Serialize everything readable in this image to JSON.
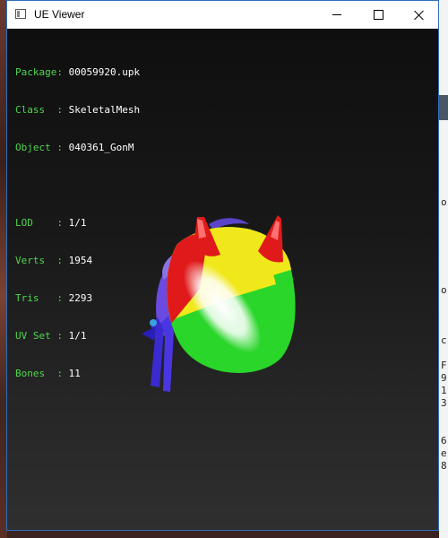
{
  "window": {
    "title": "UE Viewer",
    "controls": [
      "minimize",
      "maximize",
      "close"
    ]
  },
  "info_panel": {
    "asset": [
      {
        "key": "Package",
        "sep": ": ",
        "value": "00059920.upk"
      },
      {
        "key": "Class  ",
        "sep": ": ",
        "value": "SkeletalMesh"
      },
      {
        "key": "Object ",
        "sep": ": ",
        "value": "040361_GonM"
      }
    ],
    "stats": [
      {
        "key": "LOD    ",
        "sep": ": ",
        "value": "1/1"
      },
      {
        "key": "Verts  ",
        "sep": ": ",
        "value": "1954"
      },
      {
        "key": "Tris   ",
        "sep": ": ",
        "value": "2293"
      },
      {
        "key": "UV Set ",
        "sep": ": ",
        "value": "1/1"
      },
      {
        "key": "Bones  ",
        "sep": ": ",
        "value": "11"
      }
    ]
  },
  "background_window": {
    "chars": [
      "o",
      "o",
      "c",
      "F",
      "9",
      "1",
      "3",
      "6",
      "e",
      "8"
    ]
  },
  "colors": {
    "key_text": "#4fd64f",
    "value_text": "#ffffff",
    "viewport_top": "#0f0f0f",
    "viewport_bottom": "#2f2f2f",
    "mesh_red": "#e01a1a",
    "mesh_yellow": "#f0e81a",
    "mesh_green": "#2ad62a",
    "mesh_purple": "#6a4ae0"
  }
}
